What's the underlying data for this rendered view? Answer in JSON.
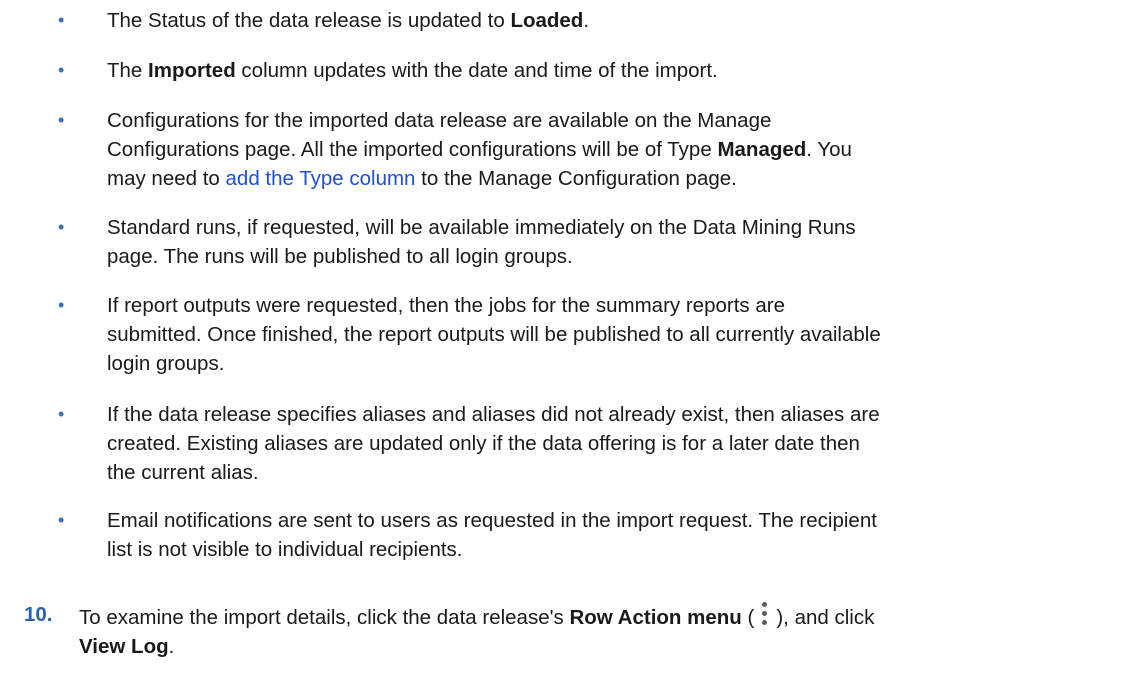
{
  "bullets": [
    {
      "parts": [
        {
          "t": "The Status of the data release is updated to "
        },
        {
          "t": "Loaded",
          "b": true
        },
        {
          "t": "."
        }
      ]
    },
    {
      "parts": [
        {
          "t": "The "
        },
        {
          "t": "Imported",
          "b": true
        },
        {
          "t": " column updates with the date and time of the import."
        }
      ]
    },
    {
      "lines": [
        [
          {
            "t": "Configurations for the imported data release are available on the Manage"
          }
        ],
        [
          {
            "t": "Configurations page. All the imported configurations will be of Type "
          },
          {
            "t": "Managed",
            "b": true
          },
          {
            "t": ". You"
          }
        ],
        [
          {
            "t": "may need to "
          },
          {
            "t": "add the Type column",
            "link": true
          },
          {
            "t": " to the Manage Configuration page."
          }
        ]
      ]
    },
    {
      "lines": [
        [
          {
            "t": "Standard runs, if requested, will be available immediately on the Data Mining Runs"
          }
        ],
        [
          {
            "t": "page. The runs will be published to all login groups."
          }
        ]
      ]
    },
    {
      "lines": [
        [
          {
            "t": "If report outputs were requested, then the jobs for the summary reports are"
          }
        ],
        [
          {
            "t": "submitted. Once finished, the report outputs will be published to all currently available"
          }
        ],
        [
          {
            "t": "login groups."
          }
        ]
      ]
    },
    {
      "lines": [
        [
          {
            "t": "If the data release specifies aliases and aliases did not already exist, then aliases are"
          }
        ],
        [
          {
            "t": "created. Existing aliases are updated only if the data offering is for a later date then"
          }
        ],
        [
          {
            "t": "the current alias."
          }
        ]
      ]
    },
    {
      "lines": [
        [
          {
            "t": "Email notifications are sent to users as requested in the import request. The recipient"
          }
        ],
        [
          {
            "t": "list is not visible to individual recipients."
          }
        ]
      ]
    }
  ],
  "step": {
    "number": "10.",
    "lines": [
      [
        {
          "t": "To examine the import details, click the data release's "
        },
        {
          "t": "Row Action menu",
          "b": true
        },
        {
          "t": " ("
        },
        {
          "icon": "kebab-menu-icon"
        },
        {
          "t": "), and click"
        }
      ],
      [
        {
          "t": "View Log",
          "b": true
        },
        {
          "t": "."
        }
      ]
    ]
  },
  "colors": {
    "bullet": "#3a6fb0",
    "step_number": "#2b61b5",
    "link": "#1f4fd6",
    "text": "#1a1a1a"
  }
}
